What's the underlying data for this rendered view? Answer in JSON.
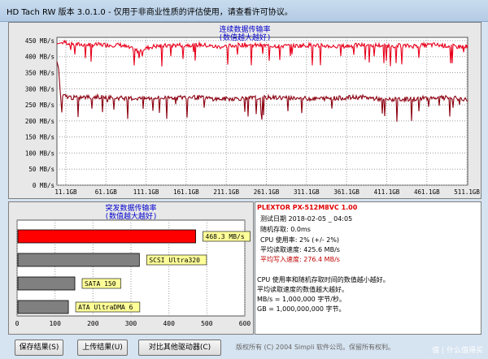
{
  "window": {
    "title": "HD Tach RW 版本 3.0.1.0 - 仅用于非商业性质的评估使用，请查看许可协议。"
  },
  "top_chart": {
    "title": "连续数据传输率",
    "subtitle": "(数值越大越好)",
    "chart_data": {
      "type": "line",
      "title": "连续数据传输率",
      "subtitle": "(数值越大越好)",
      "y_ticks": [
        "450 MB/s",
        "400 MB/s",
        "350 MB/s",
        "300 MB/s",
        "250 MB/s",
        "200 MB/s",
        "150 MB/s",
        "100 MB/s",
        "50 MB/s",
        "0 MB/s"
      ],
      "x_ticks": [
        "11.1GB",
        "61.1GB",
        "111.1GB",
        "161.1GB",
        "211.1GB",
        "261.1GB",
        "311.1GB",
        "361.1GB",
        "411.1GB",
        "461.1GB",
        "511.1GB"
      ],
      "ylim": [
        0,
        460
      ],
      "xlim": [
        0,
        512
      ],
      "grid": true,
      "series": [
        {
          "color": "#e8001c",
          "x": [
            0,
            10,
            20,
            50,
            80,
            100,
            120,
            150,
            180,
            200,
            230,
            260,
            290,
            320,
            350,
            380,
            410,
            440,
            470,
            500,
            512
          ],
          "y": [
            440,
            445,
            438,
            437,
            436,
            418,
            432,
            436,
            437,
            430,
            437,
            434,
            433,
            436,
            431,
            436,
            435,
            433,
            437,
            431,
            432
          ]
        },
        {
          "color": "#8b0010",
          "x": [
            0,
            2,
            5,
            8,
            20,
            50,
            80,
            110,
            140,
            170,
            200,
            230,
            260,
            290,
            320,
            350,
            380,
            410,
            440,
            470,
            500,
            512
          ],
          "y": [
            385,
            365,
            260,
            278,
            272,
            275,
            271,
            270,
            272,
            274,
            268,
            270,
            273,
            272,
            269,
            271,
            274,
            266,
            268,
            273,
            270,
            265
          ]
        }
      ]
    }
  },
  "burst_chart": {
    "title": "突发数据传输率",
    "subtitle": "(数值越大越好)",
    "chart_data": {
      "type": "bar",
      "title": "突发数据传输率",
      "subtitle": "(数值越大越好)",
      "categories": [
        "468.3 MB/s",
        "SCSI Ultra320",
        "SATA 150",
        "ATA UltraDMA 6"
      ],
      "values": [
        468.3,
        320,
        150,
        133
      ],
      "colors": [
        "#ff0000",
        "#808080",
        "#808080",
        "#808080"
      ],
      "x_ticks": [
        "0",
        "100",
        "200",
        "300",
        "400",
        "500",
        "600"
      ],
      "xlim": [
        0,
        600
      ]
    }
  },
  "info": {
    "drive_name": "PLEXTOR PX-512M8VC 1.00",
    "test_date": "测试日期 2018-02-05 _ 04:05",
    "random_access": "随机存取: 0.0ms",
    "cpu_usage": "CPU 使用率: 2% (+/- 2%)",
    "avg_read": "平均读取速度: 425.6 MB/s",
    "avg_write": "平均写入速度: 276.4 MB/s",
    "note1": "CPU 使用率和随机存取时间的数值越小越好。",
    "note2": "平均读取速度的数值越大越好。",
    "note3": "MB/s = 1,000,000 字节/秒。",
    "note4": "GB = 1,000,000,000 字节。"
  },
  "buttons": {
    "save": "保存结果(S)",
    "upload": "上传结果(U)",
    "compare": "对比其他驱动器(C)"
  },
  "footer": {
    "copyright": "版权所有 (C) 2004 Simpli 软件公司。保留所有权利。",
    "watermark": "值 | 什么值得买"
  }
}
